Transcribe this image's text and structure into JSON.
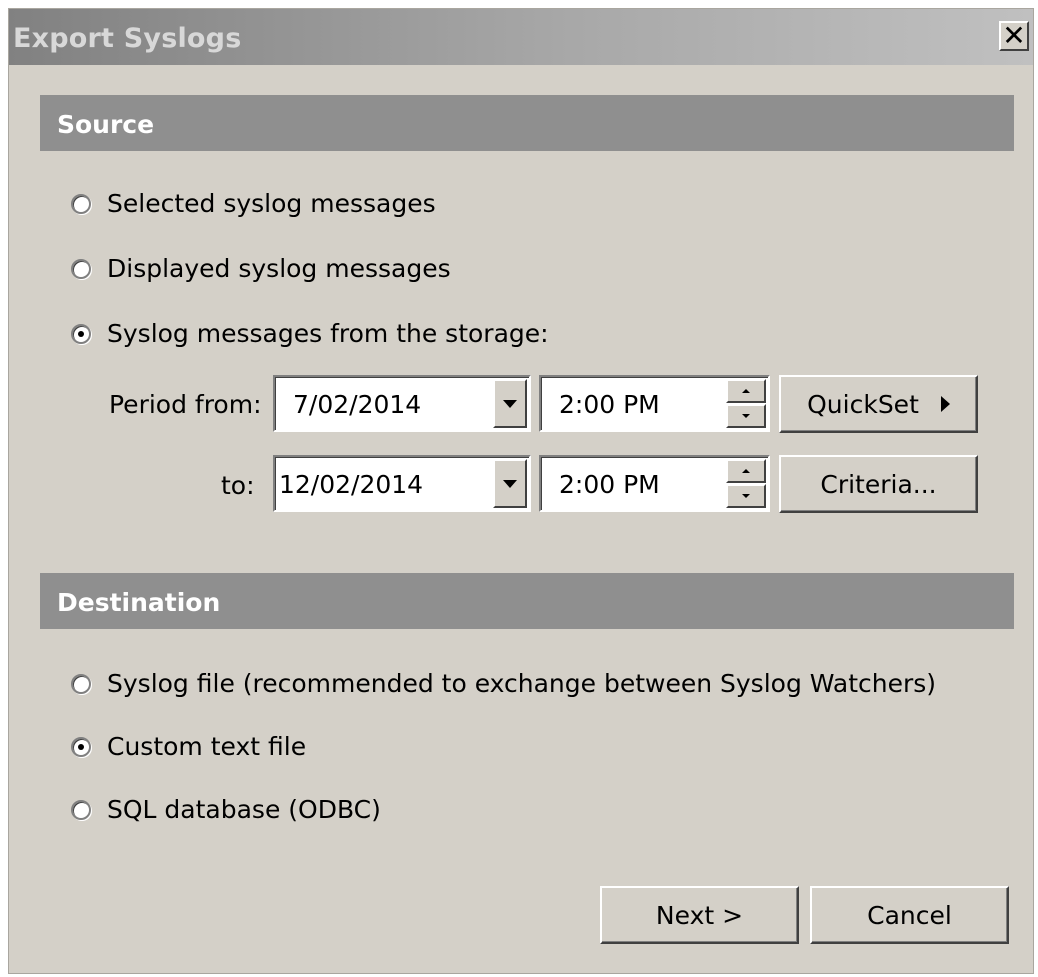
{
  "window": {
    "title": "Export Syslogs",
    "close_glyph": "✕"
  },
  "source": {
    "header": "Source",
    "options": [
      {
        "label": "Selected syslog messages",
        "checked": false
      },
      {
        "label": "Displayed syslog messages",
        "checked": false
      },
      {
        "label": "Syslog messages from the storage:",
        "checked": true
      }
    ],
    "period_from_label": "Period from:",
    "period_to_label": "to:",
    "from_date": "7/02/2014",
    "from_time": "2:00 PM",
    "to_date": "12/02/2014",
    "to_time": "2:00 PM",
    "quickset_label": "QuickSet",
    "criteria_label": "Criteria..."
  },
  "destination": {
    "header": "Destination",
    "options": [
      {
        "label": "Syslog file (recommended to exchange between Syslog Watchers)",
        "checked": false
      },
      {
        "label": "Custom text file",
        "checked": true
      },
      {
        "label": "SQL database (ODBC)",
        "checked": false
      }
    ]
  },
  "footer": {
    "next_label": "Next >",
    "cancel_label": "Cancel"
  }
}
